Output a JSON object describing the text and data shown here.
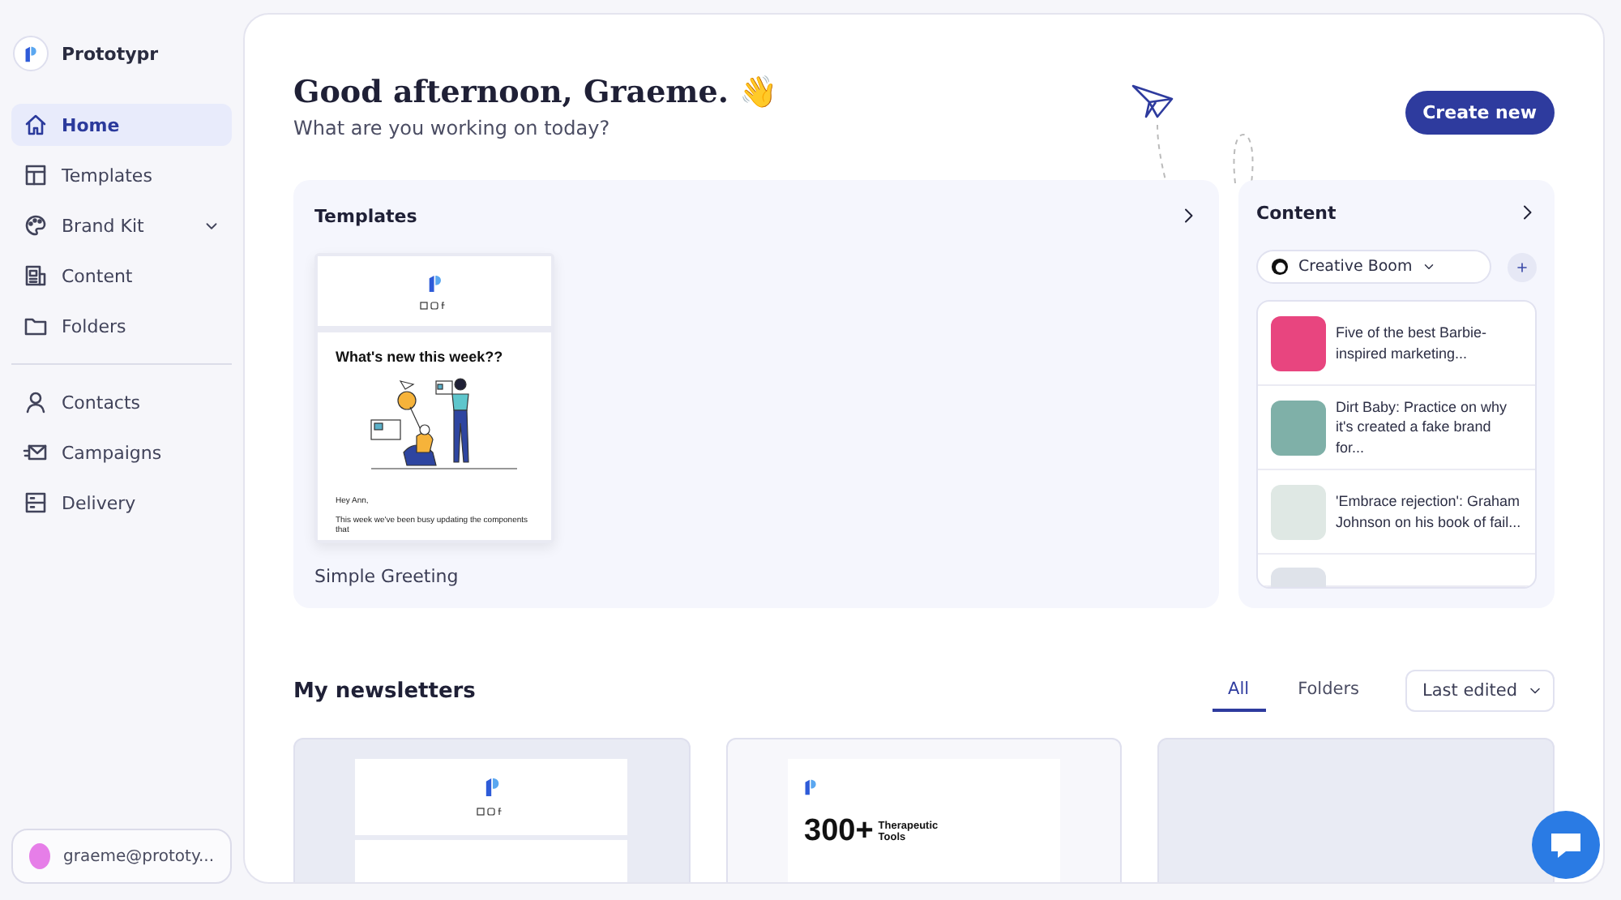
{
  "app": {
    "name": "Prototypr"
  },
  "sidebar": {
    "groups": [
      [
        {
          "label": "Home",
          "selected": true,
          "has_submenu": false
        },
        {
          "label": "Templates",
          "selected": false,
          "has_submenu": false
        },
        {
          "label": "Brand Kit",
          "selected": false,
          "has_submenu": true
        },
        {
          "label": "Content",
          "selected": false,
          "has_submenu": false
        },
        {
          "label": "Folders",
          "selected": false,
          "has_submenu": false
        }
      ],
      [
        {
          "label": "Contacts",
          "selected": false,
          "has_submenu": false
        },
        {
          "label": "Campaigns",
          "selected": false,
          "has_submenu": false
        },
        {
          "label": "Delivery",
          "selected": false,
          "has_submenu": false
        }
      ]
    ]
  },
  "user": {
    "email": "graeme@prototy..."
  },
  "header": {
    "greeting": "Good afternoon, Graeme. 👋",
    "subtitle": "What are you working on today?",
    "create_button": "Create new"
  },
  "templates": {
    "title": "Templates",
    "items": [
      {
        "name": "Simple Greeting",
        "heading": "What's new this week??",
        "lines": [
          "Hey Ann,",
          "This week we've been busy updating the components that"
        ]
      }
    ]
  },
  "content": {
    "title": "Content",
    "source": "Creative Boom",
    "articles": [
      {
        "title": "Five of the best Barbie-inspired marketing..."
      },
      {
        "title": "Dirt Baby: Practice on why it's created a fake brand for..."
      },
      {
        "title": "'Embrace rejection': Graham Johnson on his book of fail..."
      }
    ]
  },
  "newsletters": {
    "title": "My newsletters",
    "tabs": [
      {
        "label": "All",
        "selected": true
      },
      {
        "label": "Folders",
        "selected": false
      }
    ],
    "sort": "Last edited",
    "cards": [
      {
        "kind": "social"
      },
      {
        "kind": "stat",
        "big": "300+",
        "caption": "Therapeutic Tools"
      },
      {
        "kind": "empty"
      }
    ]
  }
}
